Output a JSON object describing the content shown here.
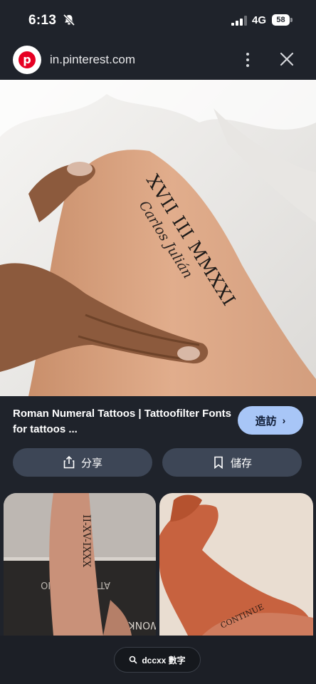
{
  "status_bar": {
    "time": "6:13",
    "network": "4G",
    "battery": "58"
  },
  "browser": {
    "url": "in.pinterest.com",
    "site_icon_letter": "p"
  },
  "pin": {
    "title": "Roman Numeral Tattoos | Tattoofilter Fonts for tattoos ...",
    "visit_label": "造訪",
    "share_label": "分享",
    "save_label": "儲存",
    "tattoo_numerals": "XVII III MMXXI",
    "tattoo_script": "Carlos Julián"
  },
  "related": {
    "left_tattoo": "II-XV-IXXX",
    "right_tattoo": "CONTINUE"
  },
  "bottom": {
    "lens_label": "dccxx 數字"
  },
  "colors": {
    "background": "#1f232b",
    "visit_button": "#a8c6f7",
    "secondary_button": "#3d4656",
    "pinterest_red": "#e60023"
  }
}
